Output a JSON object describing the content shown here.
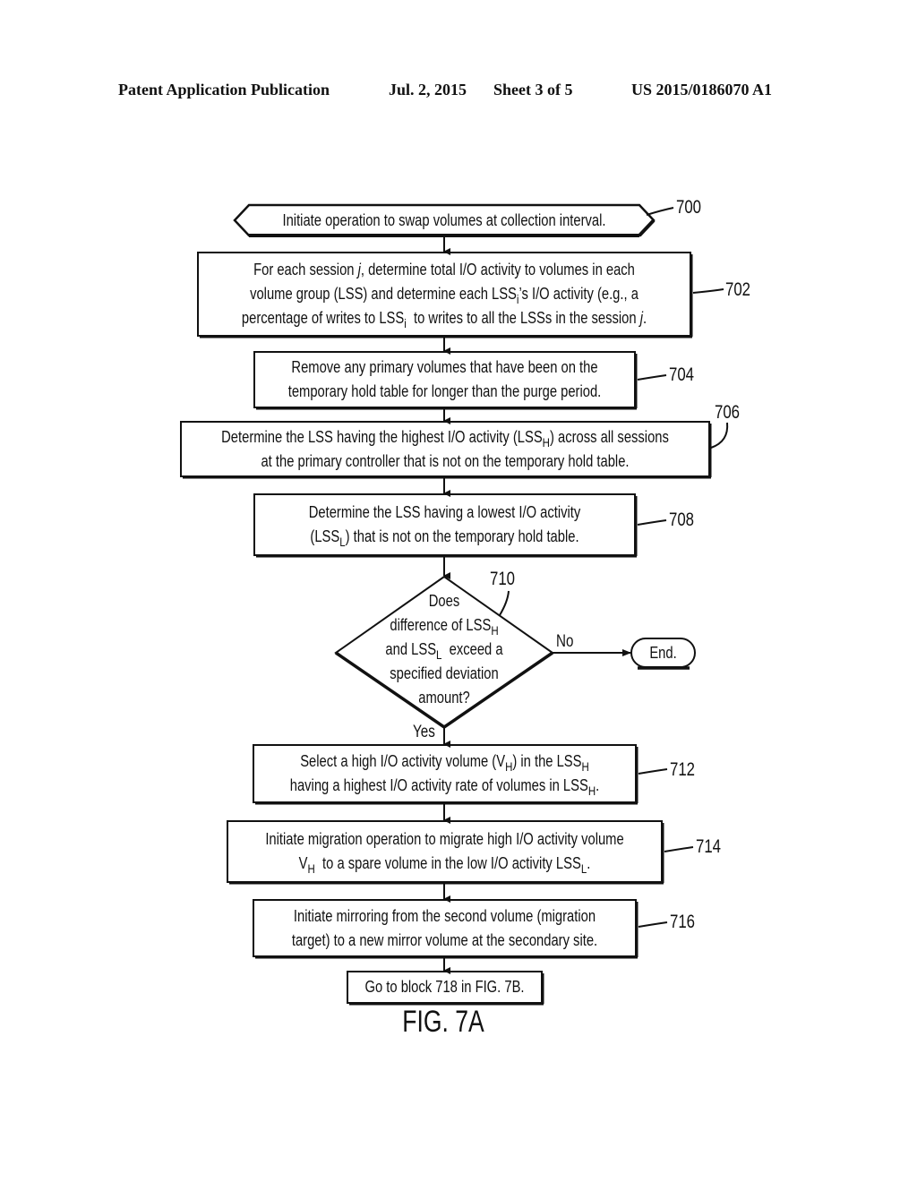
{
  "header": {
    "left": "Patent Application Publication",
    "date": "Jul. 2, 2015",
    "sheet": "Sheet 3 of 5",
    "number": "US 2015/0186070 A1"
  },
  "figure_label": "FIG. 7A",
  "flowchart": {
    "start": {
      "ref": "700",
      "text": "Initiate operation to swap volumes at collection interval."
    },
    "step_702": {
      "ref": "702",
      "line1_a": "For each session ",
      "line1_var": "j",
      "line1_b": ", determine total I/O activity to volumes in each",
      "line2_a": "volume group (LSS) and determine each LSS",
      "line2_sub": "i",
      "line2_b": "’s I/O activity (e.g., a",
      "line3_a": "percentage of writes to LSS",
      "line3_sub": "i",
      "line3_b": "  to writes to all the LSSs in the session ",
      "line3_var": "j",
      "line3_c": "."
    },
    "step_704": {
      "ref": "704",
      "line1": "Remove any primary volumes that have been on the",
      "line2": "temporary hold table for longer than the purge period."
    },
    "step_706": {
      "ref": "706",
      "line1_a": "Determine the LSS having the highest I/O activity (LSS",
      "line1_sub": "H",
      "line1_b": ") across all sessions",
      "line2": "at the primary controller that is not on the temporary hold table."
    },
    "step_708": {
      "ref": "708",
      "line1": "Determine the LSS having a lowest I/O activity",
      "line2_a": "(LSS",
      "line2_sub": "L",
      "line2_b": ") that is not on the temporary hold table."
    },
    "decision_710": {
      "ref": "710",
      "line1": "Does",
      "line2_a": "difference of LSS",
      "line2_sub": "H",
      "line3_a": "and LSS",
      "line3_sub": "L",
      "line3_b": "  exceed a",
      "line4": "specified deviation",
      "line5": "amount?",
      "no_label": "No",
      "yes_label": "Yes"
    },
    "end": {
      "text": "End."
    },
    "step_712": {
      "ref": "712",
      "line1_a": "Select a high I/O activity volume (V",
      "line1_sub1": "H",
      "line1_b": ") in the LSS",
      "line1_sub2": "H",
      "line2_a": "having a highest I/O activity rate of volumes in LSS",
      "line2_sub": "H",
      "line2_b": "."
    },
    "step_714": {
      "ref": "714",
      "line1": "Initiate migration operation to migrate high I/O activity volume",
      "line2_a": "V",
      "line2_sub1": "H",
      "line2_b": "  to a spare volume in the low I/O activity LSS",
      "line2_sub2": "L",
      "line2_c": "."
    },
    "step_716": {
      "ref": "716",
      "line1": "Initiate mirroring from the second volume (migration",
      "line2": "target) to a new mirror volume at the secondary site."
    },
    "goto": {
      "text": "Go to block 718 in FIG. 7B."
    }
  }
}
